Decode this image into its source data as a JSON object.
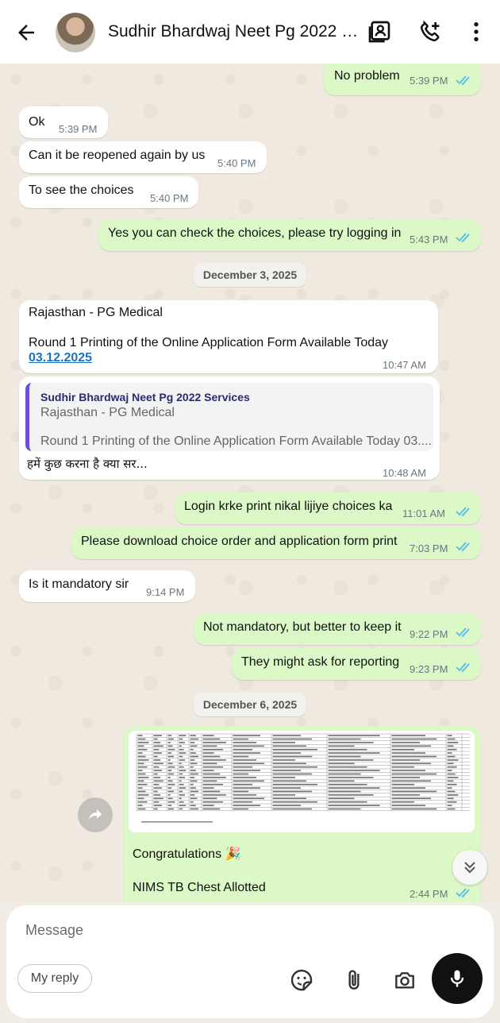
{
  "header": {
    "contact_name": "Sudhir Bhardwaj Neet Pg 2022 Ser..."
  },
  "messages": [
    {
      "dir": "out",
      "text": "No problem",
      "time": "5:39 PM"
    },
    {
      "dir": "in",
      "text": "Ok",
      "time": "5:39 PM"
    },
    {
      "dir": "in",
      "text": "Can it be reopened again by us",
      "time": "5:40 PM"
    },
    {
      "dir": "in",
      "text": "To see the choices",
      "time": "5:40 PM"
    },
    {
      "dir": "out",
      "text": "Yes you can check the choices, please try logging in",
      "time": "5:43 PM"
    },
    {
      "dir": "in",
      "line1": "Rajasthan - PG Medical",
      "line2": "Round 1 Printing of the Online Application Form Available Today",
      "link": "03.12.2025",
      "time": "10:47 AM"
    },
    {
      "dir": "in",
      "quote_name": "Sudhir Bhardwaj Neet Pg 2022 Services",
      "quote_line1": "Rajasthan - PG Medical",
      "quote_line2": "Round 1 Printing of the Online Application Form Available Today 03....",
      "text": "हमें कुछ करना है क्या सर...",
      "time": "10:48 AM"
    },
    {
      "dir": "out",
      "text": "Login krke print nikal lijiye choices ka",
      "time": "11:01 AM"
    },
    {
      "dir": "out",
      "text": "Please download choice order and application form print",
      "time": "7:03 PM"
    },
    {
      "dir": "in",
      "text": "Is it mandatory sir",
      "time": "9:14 PM"
    },
    {
      "dir": "out",
      "text": "Not mandatory, but better to keep it",
      "time": "9:22 PM"
    },
    {
      "dir": "out",
      "text": "They might ask for reporting",
      "time": "9:23 PM"
    },
    {
      "dir": "out",
      "caption1": "Congratulations 🎉",
      "caption2": "NIMS TB Chest Allotted",
      "time": "2:44 PM"
    }
  ],
  "dates": [
    "December 3, 2025",
    "December 6, 2025"
  ],
  "composer": {
    "placeholder": "Message",
    "my_reply": "My reply"
  },
  "colors": {
    "outgoing_bubble": "#dcf8c6",
    "incoming_bubble": "#ffffff",
    "read_ticks": "#53bdeb",
    "link": "#1a73c4"
  }
}
